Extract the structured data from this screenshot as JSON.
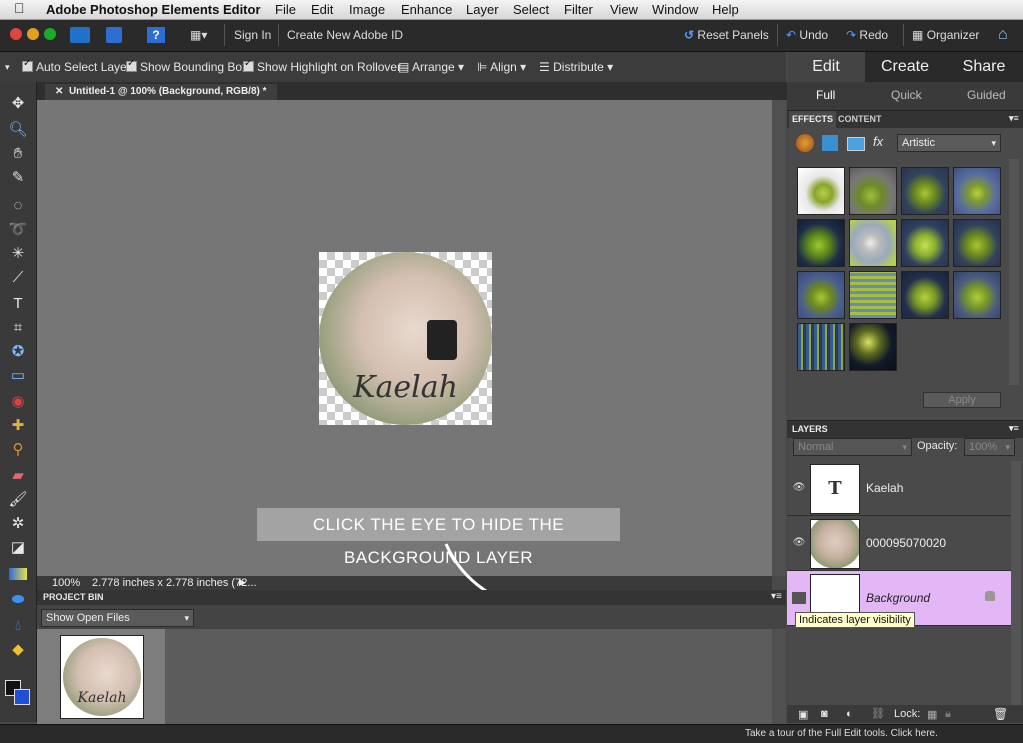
{
  "menubar": {
    "app_name": "Adobe Photoshop Elements Editor",
    "menus": [
      "File",
      "Edit",
      "Image",
      "Enhance",
      "Layer",
      "Select",
      "Filter",
      "View",
      "Window",
      "Help"
    ]
  },
  "appbar": {
    "sign_in": "Sign In",
    "create_id": "Create New Adobe ID",
    "reset_panels": "Reset Panels",
    "undo": "Undo",
    "redo": "Redo",
    "organizer": "Organizer"
  },
  "options": {
    "auto_select": "Auto Select Layer",
    "bounding_box": "Show Bounding Box",
    "highlight": "Show Highlight on Rollover",
    "arrange": "Arrange",
    "align": "Align",
    "distribute": "Distribute"
  },
  "document": {
    "tab_title": "Untitled-1 @ 100% (Background, RGB/8) *",
    "zoom": "100%",
    "size_info": "2.778 inches x 2.778 inches (72...",
    "image_text": "Kaelah"
  },
  "banner": {
    "text": "CLICK THE EYE TO HIDE THE BACKGROUND LAYER"
  },
  "project_bin": {
    "title": "PROJECT BIN",
    "filter": "Show Open Files",
    "thumb_text": "Kaelah"
  },
  "mode_tabs": [
    "Edit",
    "Create",
    "Share"
  ],
  "sub_tabs": [
    "Full",
    "Quick",
    "Guided"
  ],
  "effects": {
    "tabs": [
      "EFFECTS",
      "CONTENT"
    ],
    "category": "Artistic",
    "apply": "Apply",
    "thumb_count_note": ""
  },
  "layers": {
    "title": "LAYERS",
    "blend": "Normal",
    "opacity_label": "Opacity:",
    "opacity_value": "100%",
    "items": [
      {
        "name": "Kaelah",
        "type_glyph": "T"
      },
      {
        "name": "000095070020"
      },
      {
        "name": "Background"
      }
    ],
    "lock_label": "Lock:"
  },
  "tooltip": "Indicates layer visibility",
  "footer": {
    "tour": "Take a tour of the Full Edit tools. Click here."
  },
  "colors": {
    "selected_layer": "#e3b6f5",
    "appbar": "#2a2a2a",
    "canvas": "#767676"
  }
}
